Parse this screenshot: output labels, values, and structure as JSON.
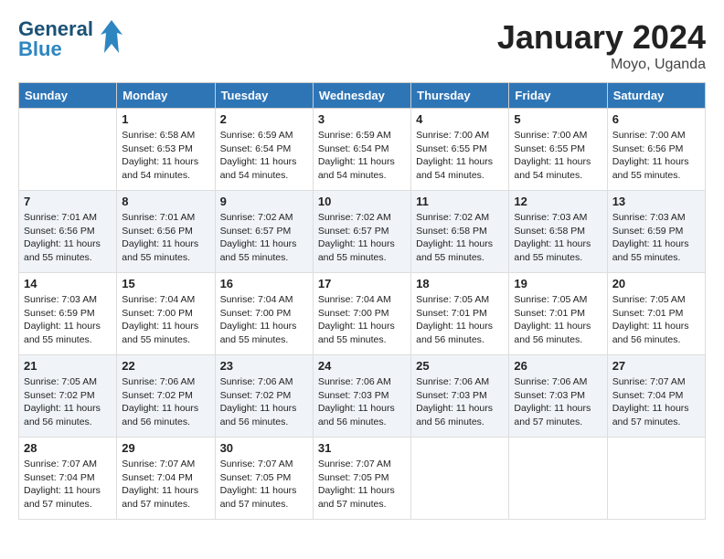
{
  "header": {
    "logo_line1": "General",
    "logo_line2": "Blue",
    "month": "January 2024",
    "location": "Moyo, Uganda"
  },
  "weekdays": [
    "Sunday",
    "Monday",
    "Tuesday",
    "Wednesday",
    "Thursday",
    "Friday",
    "Saturday"
  ],
  "weeks": [
    [
      {
        "day": "",
        "info": ""
      },
      {
        "day": "1",
        "info": "Sunrise: 6:58 AM\nSunset: 6:53 PM\nDaylight: 11 hours\nand 54 minutes."
      },
      {
        "day": "2",
        "info": "Sunrise: 6:59 AM\nSunset: 6:54 PM\nDaylight: 11 hours\nand 54 minutes."
      },
      {
        "day": "3",
        "info": "Sunrise: 6:59 AM\nSunset: 6:54 PM\nDaylight: 11 hours\nand 54 minutes."
      },
      {
        "day": "4",
        "info": "Sunrise: 7:00 AM\nSunset: 6:55 PM\nDaylight: 11 hours\nand 54 minutes."
      },
      {
        "day": "5",
        "info": "Sunrise: 7:00 AM\nSunset: 6:55 PM\nDaylight: 11 hours\nand 54 minutes."
      },
      {
        "day": "6",
        "info": "Sunrise: 7:00 AM\nSunset: 6:56 PM\nDaylight: 11 hours\nand 55 minutes."
      }
    ],
    [
      {
        "day": "7",
        "info": "Sunrise: 7:01 AM\nSunset: 6:56 PM\nDaylight: 11 hours\nand 55 minutes."
      },
      {
        "day": "8",
        "info": "Sunrise: 7:01 AM\nSunset: 6:56 PM\nDaylight: 11 hours\nand 55 minutes."
      },
      {
        "day": "9",
        "info": "Sunrise: 7:02 AM\nSunset: 6:57 PM\nDaylight: 11 hours\nand 55 minutes."
      },
      {
        "day": "10",
        "info": "Sunrise: 7:02 AM\nSunset: 6:57 PM\nDaylight: 11 hours\nand 55 minutes."
      },
      {
        "day": "11",
        "info": "Sunrise: 7:02 AM\nSunset: 6:58 PM\nDaylight: 11 hours\nand 55 minutes."
      },
      {
        "day": "12",
        "info": "Sunrise: 7:03 AM\nSunset: 6:58 PM\nDaylight: 11 hours\nand 55 minutes."
      },
      {
        "day": "13",
        "info": "Sunrise: 7:03 AM\nSunset: 6:59 PM\nDaylight: 11 hours\nand 55 minutes."
      }
    ],
    [
      {
        "day": "14",
        "info": "Sunrise: 7:03 AM\nSunset: 6:59 PM\nDaylight: 11 hours\nand 55 minutes."
      },
      {
        "day": "15",
        "info": "Sunrise: 7:04 AM\nSunset: 7:00 PM\nDaylight: 11 hours\nand 55 minutes."
      },
      {
        "day": "16",
        "info": "Sunrise: 7:04 AM\nSunset: 7:00 PM\nDaylight: 11 hours\nand 55 minutes."
      },
      {
        "day": "17",
        "info": "Sunrise: 7:04 AM\nSunset: 7:00 PM\nDaylight: 11 hours\nand 55 minutes."
      },
      {
        "day": "18",
        "info": "Sunrise: 7:05 AM\nSunset: 7:01 PM\nDaylight: 11 hours\nand 56 minutes."
      },
      {
        "day": "19",
        "info": "Sunrise: 7:05 AM\nSunset: 7:01 PM\nDaylight: 11 hours\nand 56 minutes."
      },
      {
        "day": "20",
        "info": "Sunrise: 7:05 AM\nSunset: 7:01 PM\nDaylight: 11 hours\nand 56 minutes."
      }
    ],
    [
      {
        "day": "21",
        "info": "Sunrise: 7:05 AM\nSunset: 7:02 PM\nDaylight: 11 hours\nand 56 minutes."
      },
      {
        "day": "22",
        "info": "Sunrise: 7:06 AM\nSunset: 7:02 PM\nDaylight: 11 hours\nand 56 minutes."
      },
      {
        "day": "23",
        "info": "Sunrise: 7:06 AM\nSunset: 7:02 PM\nDaylight: 11 hours\nand 56 minutes."
      },
      {
        "day": "24",
        "info": "Sunrise: 7:06 AM\nSunset: 7:03 PM\nDaylight: 11 hours\nand 56 minutes."
      },
      {
        "day": "25",
        "info": "Sunrise: 7:06 AM\nSunset: 7:03 PM\nDaylight: 11 hours\nand 56 minutes."
      },
      {
        "day": "26",
        "info": "Sunrise: 7:06 AM\nSunset: 7:03 PM\nDaylight: 11 hours\nand 57 minutes."
      },
      {
        "day": "27",
        "info": "Sunrise: 7:07 AM\nSunset: 7:04 PM\nDaylight: 11 hours\nand 57 minutes."
      }
    ],
    [
      {
        "day": "28",
        "info": "Sunrise: 7:07 AM\nSunset: 7:04 PM\nDaylight: 11 hours\nand 57 minutes."
      },
      {
        "day": "29",
        "info": "Sunrise: 7:07 AM\nSunset: 7:04 PM\nDaylight: 11 hours\nand 57 minutes."
      },
      {
        "day": "30",
        "info": "Sunrise: 7:07 AM\nSunset: 7:05 PM\nDaylight: 11 hours\nand 57 minutes."
      },
      {
        "day": "31",
        "info": "Sunrise: 7:07 AM\nSunset: 7:05 PM\nDaylight: 11 hours\nand 57 minutes."
      },
      {
        "day": "",
        "info": ""
      },
      {
        "day": "",
        "info": ""
      },
      {
        "day": "",
        "info": ""
      }
    ]
  ]
}
